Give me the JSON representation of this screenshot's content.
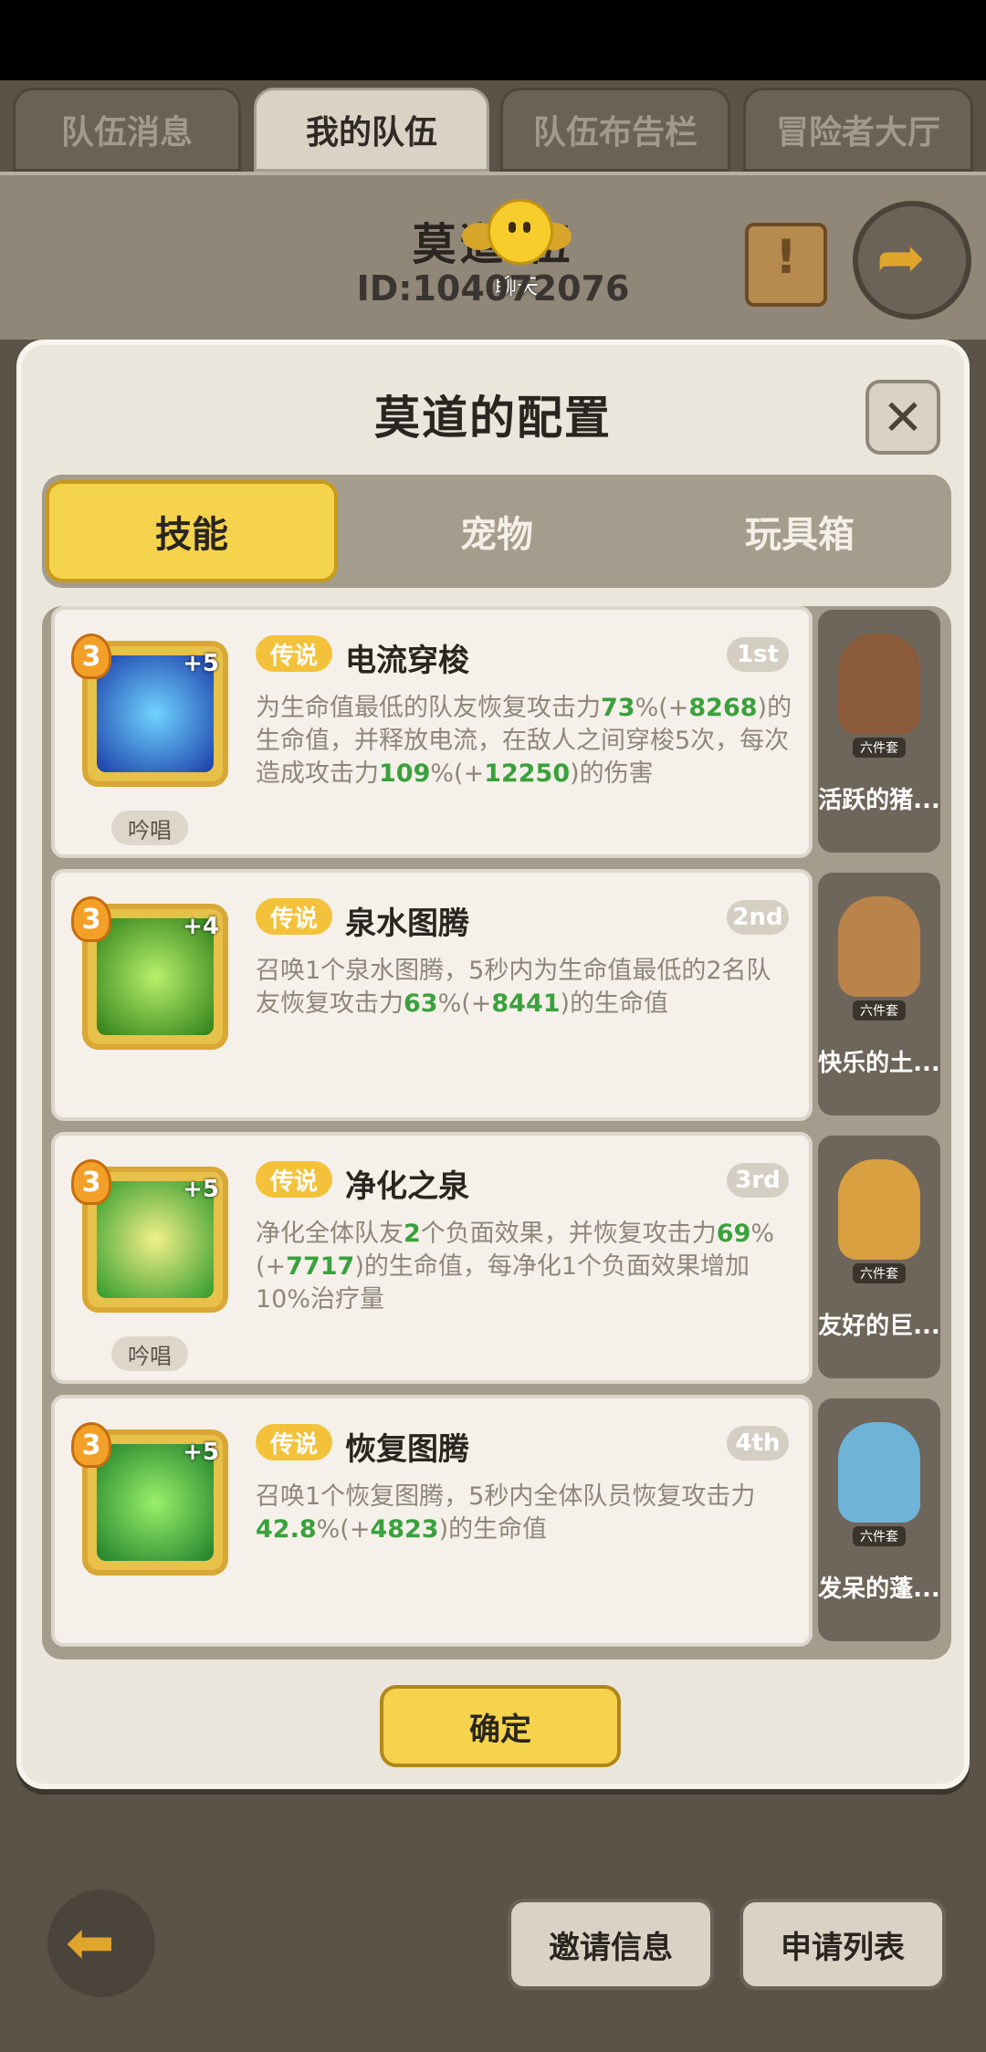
{
  "top_tabs": [
    {
      "label": "队伍消息"
    },
    {
      "label": "我的队伍"
    },
    {
      "label": "队伍布告栏"
    },
    {
      "label": "冒险者大厅"
    }
  ],
  "team": {
    "name": "莫道  伍",
    "id": "ID:104072076",
    "chat_label": "聊天"
  },
  "modal": {
    "title": "莫道的配置",
    "tabs": [
      {
        "label": "技能"
      },
      {
        "label": "宠物"
      },
      {
        "label": "玩具箱"
      }
    ],
    "confirm": "确定"
  },
  "skills": [
    {
      "rank": "3",
      "plus": "+5",
      "rarity": "传说",
      "name": "电流穿梭",
      "order": "1st",
      "tag": "吟唱",
      "desc_parts": [
        "为生命值最低的队友恢复攻击力",
        "73",
        "%(+",
        "8268",
        ")的生命值，并释放电流，在敌人之间穿梭5次，每次造成攻击力",
        "109",
        "%(+",
        "12250",
        ")的伤害"
      ]
    },
    {
      "rank": "3",
      "plus": "+4",
      "rarity": "传说",
      "name": "泉水图腾",
      "order": "2nd",
      "tag": "",
      "desc_parts": [
        "召唤1个泉水图腾，5秒内为生命值最低的2名队友恢复攻击力",
        "63",
        "%(+",
        "8441",
        ")的生命值"
      ]
    },
    {
      "rank": "3",
      "plus": "+5",
      "rarity": "传说",
      "name": "净化之泉",
      "order": "3rd",
      "tag": "吟唱",
      "desc_parts": [
        "净化全体队友",
        "2",
        "个负面效果，并恢复攻击力",
        "69",
        "%(+",
        "7717",
        ")的生命值，每净化1个负面效果增加10%治疗量"
      ]
    },
    {
      "rank": "3",
      "plus": "+5",
      "rarity": "传说",
      "name": "恢复图腾",
      "order": "4th",
      "tag": "",
      "desc_parts": [
        "召唤1个恢复图腾，5秒内全体队员恢复攻击力",
        "42.8",
        "%(+",
        "4823",
        ")的生命值"
      ]
    }
  ],
  "pets": [
    {
      "name": "活跃的猪...",
      "set": "六件套",
      "color": "#8a5a3a"
    },
    {
      "name": "快乐的土...",
      "set": "六件套",
      "color": "#b9834a"
    },
    {
      "name": "友好的巨...",
      "set": "六件套",
      "color": "#d8a040"
    },
    {
      "name": "发呆的蓬...",
      "set": "六件套",
      "color": "#6fb4d8"
    }
  ],
  "bottom": {
    "invite": "邀请信息",
    "apply": "申请列表"
  },
  "colors": {
    "accent": "#f5d34d",
    "green_value": "#3aa13c"
  }
}
